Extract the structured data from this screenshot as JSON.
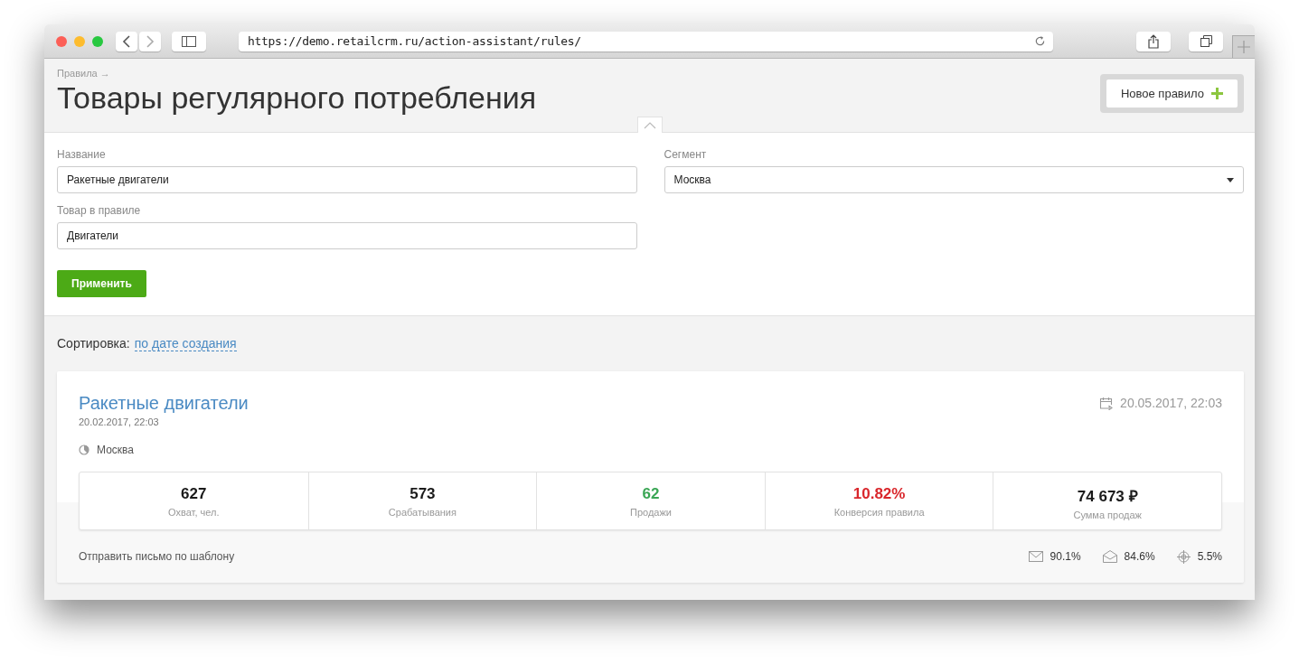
{
  "browser": {
    "url": "https://demo.retailcrm.ru/action-assistant/rules/"
  },
  "header": {
    "breadcrumb": "Правила →",
    "title": "Товары регулярного потребления",
    "new_button": "Новое правило"
  },
  "form": {
    "expanded": true,
    "fields": [
      {
        "label": "Название",
        "value": "Ракетные двигатели",
        "kind": "text"
      },
      {
        "label": "Сегмент",
        "value": "Москва",
        "kind": "select"
      },
      {
        "label": "Товар в правиле",
        "value": "Двигатели",
        "kind": "text"
      }
    ],
    "apply_button": "Применить"
  },
  "sorting": {
    "label": "Сортировка:",
    "value": "по дате создания"
  },
  "rule": {
    "title": "Ракетные двигатели",
    "created": "20.02.2017, 22:03",
    "segment": "Москва",
    "scheduled": "20.05.2017, 22:03",
    "stats": [
      {
        "value": "627",
        "label": "Охват, чел.",
        "color": "#1a1a1a"
      },
      {
        "value": "573",
        "label": "Срабатывания",
        "color": "#1a1a1a"
      },
      {
        "value": "62",
        "label": "Продажи",
        "color": "#3aa655"
      },
      {
        "value": "10.82%",
        "label": "Конверсия правила",
        "color": "#d9262b"
      },
      {
        "value": "74 673 ₽",
        "label": "Сумма продаж",
        "color": "#1a1a1a"
      }
    ],
    "action": "Отправить письмо по шаблону",
    "metrics": [
      {
        "kind": "sent",
        "value": "90.1%"
      },
      {
        "kind": "opened",
        "value": "84.6%"
      },
      {
        "kind": "clicked",
        "value": "5.5%"
      }
    ]
  }
}
